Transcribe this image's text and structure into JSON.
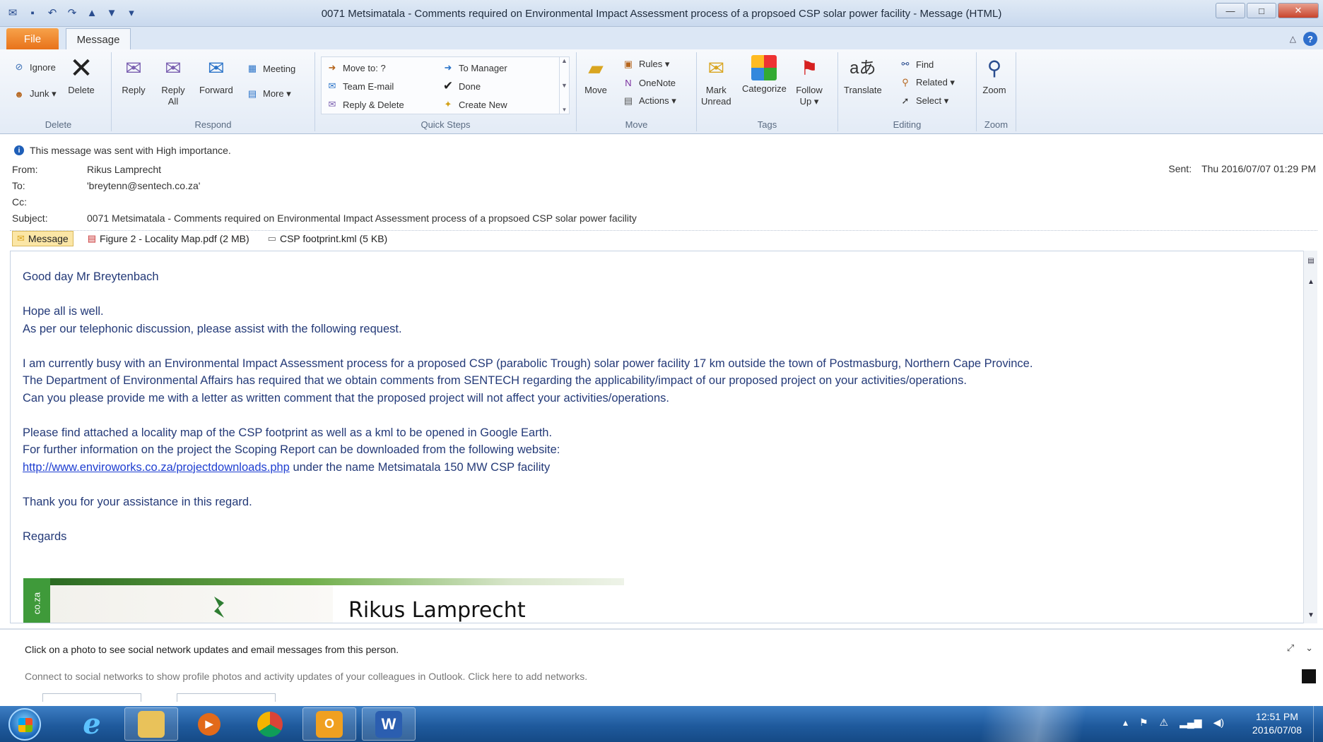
{
  "window": {
    "title": "0071 Metsimatala - Comments required on Environmental Impact Assessment process of a propsoed CSP solar power facility  -  Message (HTML)",
    "controls": {
      "minimize": "—",
      "maximize": "□",
      "close": "✕"
    }
  },
  "tabs": {
    "file": "File",
    "message": "Message"
  },
  "ribbon": {
    "delete_group": {
      "label": "Delete",
      "ignore": "Ignore",
      "junk": "Junk ▾",
      "delete": "Delete"
    },
    "respond_group": {
      "label": "Respond",
      "reply": "Reply",
      "reply_all_1": "Reply",
      "reply_all_2": "All",
      "forward": "Forward",
      "meeting": "Meeting",
      "more": "More ▾"
    },
    "quick_steps": {
      "label": "Quick Steps",
      "move_to": "Move to: ?",
      "team_email": "Team E-mail",
      "reply_delete": "Reply & Delete",
      "to_manager": "To Manager",
      "done": "Done",
      "create_new": "Create New"
    },
    "move_group": {
      "label": "Move",
      "move": "Move",
      "rules": "Rules ▾",
      "onenote": "OneNote",
      "actions": "Actions ▾"
    },
    "tags_group": {
      "label": "Tags",
      "mark_unread_1": "Mark",
      "mark_unread_2": "Unread",
      "categorize": "Categorize",
      "follow_up_1": "Follow",
      "follow_up_2": "Up ▾"
    },
    "editing_group": {
      "label": "Editing",
      "translate": "Translate",
      "find": "Find",
      "related": "Related ▾",
      "select": "Select ▾"
    },
    "zoom_group": {
      "label": "Zoom",
      "zoom": "Zoom"
    }
  },
  "header": {
    "importance": "This message was sent with High importance.",
    "from_label": "From:",
    "from_value": "Rikus Lamprecht",
    "to_label": "To:",
    "to_value": "'breytenn@sentech.co.za'",
    "cc_label": "Cc:",
    "cc_value": "",
    "subject_label": "Subject:",
    "subject_value": "0071 Metsimatala - Comments required on Environmental Impact Assessment process of a propsoed CSP solar power facility",
    "sent_label": "Sent:",
    "sent_value": "Thu 2016/07/07 01:29 PM"
  },
  "attachments": [
    {
      "label": "Message"
    },
    {
      "label": "Figure 2 - Locality Map.pdf (2 MB)"
    },
    {
      "label": "CSP footprint.kml (5 KB)"
    }
  ],
  "body": {
    "greeting": "Good day Mr Breytenbach",
    "p1_line1": "Hope all is well.",
    "p1_line2": "As per our telephonic discussion, please assist with the following request.",
    "p2_line1": "I am currently busy with an Environmental Impact Assessment process for a proposed CSP (parabolic Trough) solar power facility 17 km outside the town of Postmasburg, Northern Cape Province.",
    "p2_line2": "The Department of Environmental Affairs has required that we obtain comments from SENTECH regarding the applicability/impact of our proposed project on your activities/operations.",
    "p2_line3": "Can you please provide me with a letter as written comment that the proposed project will not affect your activities/operations.",
    "p3_line1": "Please find attached a locality map of the CSP footprint as well as a kml to be opened in Google Earth.",
    "p3_line2": "For further information on the project the Scoping Report can be downloaded from the following website:",
    "link": "http://www.enviroworks.co.za/projectdownloads.php",
    "link_suffix": " under the name Metsimatala 150 MW CSP facility",
    "thanks": "Thank you for your assistance in this regard.",
    "regards": "Regards",
    "signature_name": "Rikus Lamprecht",
    "signature_side": "co.za"
  },
  "people_pane": {
    "line1": "Click on a photo to see social network updates and email messages from this person.",
    "line2": "Connect to social networks to show profile photos and activity updates of your colleagues in Outlook. Click here to add networks."
  },
  "taskbar": {
    "time": "12:51 PM",
    "date": "2016/07/08"
  },
  "colors": {
    "file_tab": "#e8721a",
    "link": "#1f3fd1",
    "body_text": "#243a78",
    "taskbar": "#1f5a9d"
  }
}
